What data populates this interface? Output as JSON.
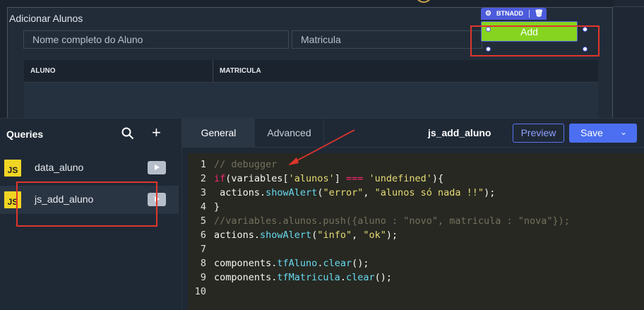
{
  "canvas": {
    "container_title": "Adicionar Alunos",
    "inputs": {
      "nome_placeholder": "Nome completo do Aluno",
      "matricula_placeholder": "Matricula"
    },
    "button_widget": {
      "name_badge": "BTNADD",
      "label": "Add",
      "color": "#86d420"
    },
    "table": {
      "columns": [
        "ALUNO",
        "MATRICULA"
      ]
    }
  },
  "sidebar": {
    "title": "Queries",
    "search_icon": "search-icon",
    "add_icon": "plus-icon",
    "queries": [
      {
        "icon": "JS",
        "label": "data_aluno",
        "selected": false
      },
      {
        "icon": "JS",
        "label": "js_add_aluno",
        "selected": true
      }
    ]
  },
  "editor": {
    "tabs": [
      "General",
      "Advanced"
    ],
    "active_tab": "General",
    "query_name": "js_add_aluno",
    "preview_label": "Preview",
    "save_label": "Save",
    "accent_color": "#4b6ff0",
    "code_lines": [
      "// debugger",
      "if(variables['alunos'] === 'undefined'){",
      " actions.showAlert(\"error\", \"alunos só nada !!\");",
      "}",
      "//variables.alunos.push({aluno : \"novo\", matricula : \"nova\"});",
      "actions.showAlert(\"info\", \"ok\");",
      "",
      "components.tfAluno.clear();",
      "components.tfMatricula.clear();",
      ""
    ]
  }
}
